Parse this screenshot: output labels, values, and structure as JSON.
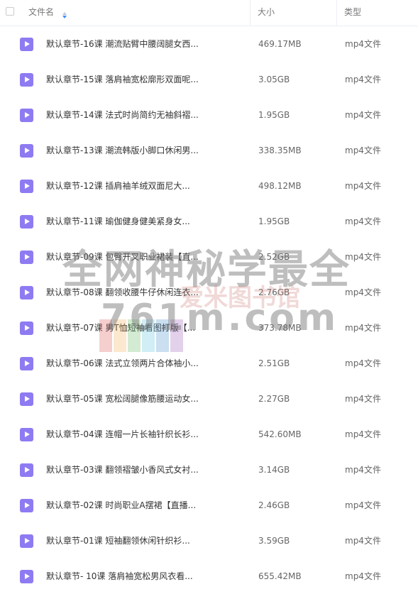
{
  "header": {
    "name_label": "文件名",
    "size_label": "大小",
    "type_label": "类型"
  },
  "files": [
    {
      "name": "默认章节-16课 潮流贴臂中腰阔腿女西...",
      "size": "469.17MB",
      "type": "mp4文件"
    },
    {
      "name": "默认章节-15课 落肩袖宽松廓形双面呢...",
      "size": "3.05GB",
      "type": "mp4文件"
    },
    {
      "name": "默认章节-14课 法式时尚简约无袖斜褶...",
      "size": "1.95GB",
      "type": "mp4文件"
    },
    {
      "name": "默认章节-13课 潮流韩版小脚口休闲男...",
      "size": "338.35MB",
      "type": "mp4文件"
    },
    {
      "name": "默认章节-12课 插肩袖羊绒双面尼大...",
      "size": "498.12MB",
      "type": "mp4文件"
    },
    {
      "name": "默认章节-11课 瑜伽健身健美紧身女...",
      "size": "1.95GB",
      "type": "mp4文件"
    },
    {
      "name": "默认章节-09课 包臀开叉职业裙装【直...",
      "size": "2.52GB",
      "type": "mp4文件"
    },
    {
      "name": "默认章节-08课 翻领收腰牛仔休闲连衣...",
      "size": "2.76GB",
      "type": "mp4文件"
    },
    {
      "name": "默认章节-07课 男T恤短袖看图打版【...",
      "size": "373.78MB",
      "type": "mp4文件"
    },
    {
      "name": "默认章节-06课 法式立领两片合体袖小...",
      "size": "2.51GB",
      "type": "mp4文件"
    },
    {
      "name": "默认章节-05课 宽松阔腿像筋腰运动女...",
      "size": "2.27GB",
      "type": "mp4文件"
    },
    {
      "name": "默认章节-04课 连帽一片长袖针织长衫...",
      "size": "542.60MB",
      "type": "mp4文件"
    },
    {
      "name": "默认章节-03课 翻领褶皱小香风式女衬...",
      "size": "3.14GB",
      "type": "mp4文件"
    },
    {
      "name": "默认章节-02课 时尚职业A摆裙【直播...",
      "size": "2.46GB",
      "type": "mp4文件"
    },
    {
      "name": "默认章节-01课 短袖翻领休闲针织衫...",
      "size": "3.59GB",
      "type": "mp4文件"
    },
    {
      "name": "默认章节- 10课 落肩袖宽松男风衣看...",
      "size": "655.42MB",
      "type": "mp4文件"
    }
  ],
  "watermark": {
    "line1": "全网神秘学最全",
    "line2": "761m.com",
    "line3": "爱米图书馆"
  },
  "colors": {
    "video_icon": "#8e7bf2",
    "sort_active": "#3b8cff",
    "divider": "#eceff3"
  }
}
